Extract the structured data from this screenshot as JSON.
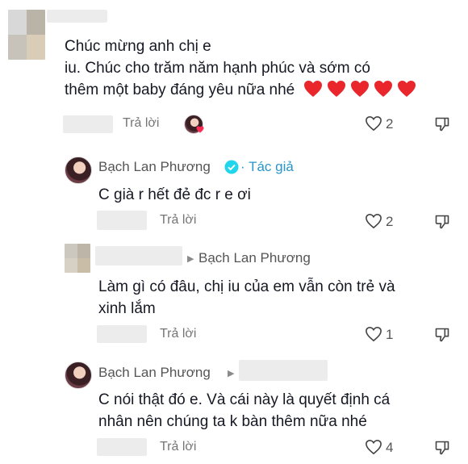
{
  "comments": [
    {
      "text_lines": [
        "Chúc mừng anh chị e",
        "iu. Chúc cho trăm năm hạnh phúc và sớm có",
        "thêm một baby đáng yêu nữa nhé"
      ],
      "emoji": [
        "red-heart",
        "red-heart",
        "red-heart",
        "red-heart",
        "red-heart"
      ],
      "reply_label": "Trả lời",
      "likes": "2"
    },
    {
      "author": "Bạch Lan Phương",
      "author_badge": "verified-icon",
      "author_tag": "· Tác giả",
      "text": "C già r hết đẻ đc r e ơi",
      "reply_label": "Trả lời",
      "likes": "2"
    },
    {
      "reply_to": "Bạch Lan Phương",
      "text_lines": [
        "Làm gì có đâu, chị iu của em vẫn còn trẻ và",
        "xinh lắm"
      ],
      "reply_label": "Trả lời",
      "likes": "1"
    },
    {
      "author": "Bạch Lan Phương",
      "text_lines": [
        "C nói thật đó e. Và cái này là quyết định cá",
        "nhân nên chúng ta k bàn thêm nữa nhé"
      ],
      "reply_label": "Trả lời",
      "likes": "4"
    }
  ],
  "colors": {
    "heart_red": "#e8262b",
    "verified": "#20d5ec",
    "tag": "#2a95c9"
  }
}
